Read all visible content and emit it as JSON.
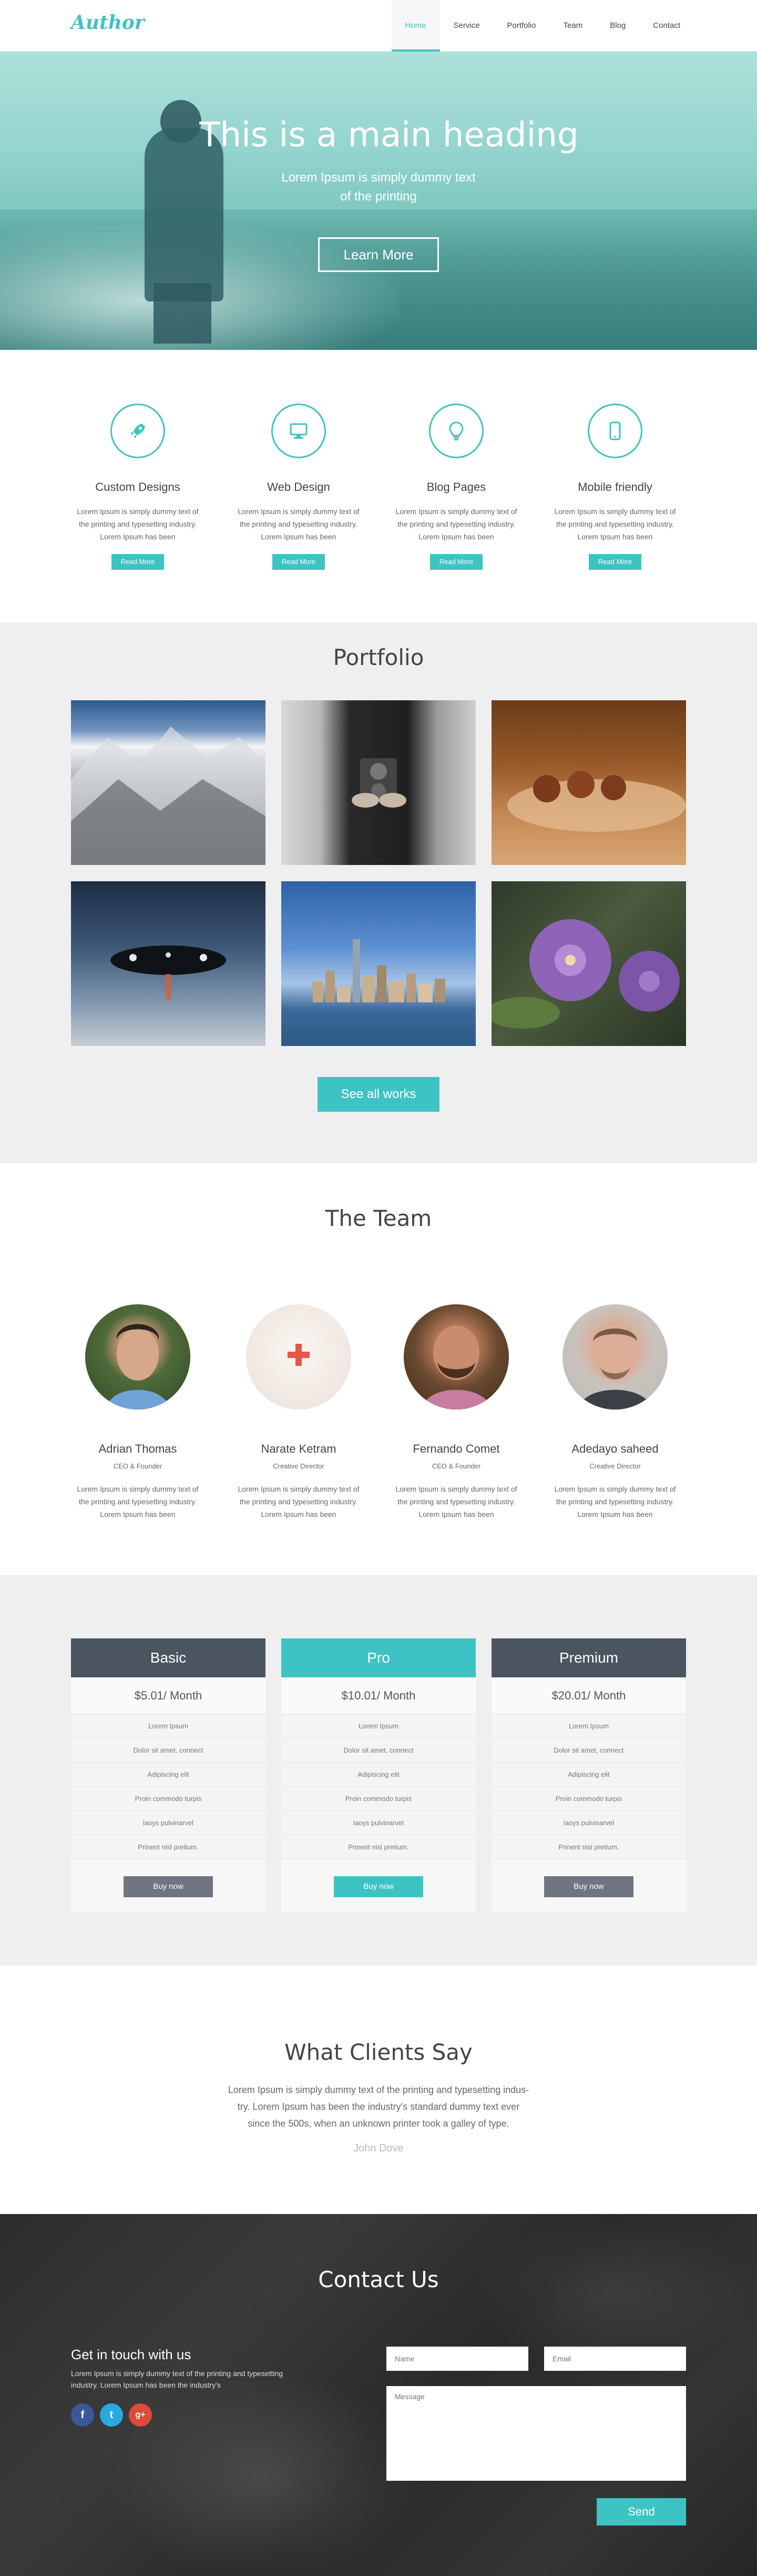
{
  "nav": {
    "logo": "Author",
    "items": [
      "Home",
      "Service",
      "Portfolio",
      "Team",
      "Blog",
      "Contact"
    ],
    "active": "Home"
  },
  "hero": {
    "heading": "This is a main heading",
    "sub_line1": "Lorem Ipsum is simply dummy text",
    "sub_line2": "of the printing",
    "button": "Learn More"
  },
  "services": [
    {
      "icon": "rocket-icon",
      "title": "Custom Designs",
      "line1": "Lorem Ipsum is simply dummy text of",
      "line2": "the printing and typesetting industry.",
      "line3": "Lorem Ipsum has been",
      "button": "Read More"
    },
    {
      "icon": "monitor-icon",
      "title": "Web Design",
      "line1": "Lorem Ipsum is simply dummy text of",
      "line2": "the printing and typesetting industry.",
      "line3": "Lorem Ipsum has been",
      "button": "Read More"
    },
    {
      "icon": "lightbulb-icon",
      "title": "Blog Pages",
      "line1": "Lorem Ipsum is simply dummy text of",
      "line2": "the printing and typesetting industry.",
      "line3": "Lorem Ipsum has been",
      "button": "Read More"
    },
    {
      "icon": "mobile-icon",
      "title": "Mobile friendly",
      "line1": "Lorem Ipsum is simply dummy text of",
      "line2": "the printing and typesetting industry.",
      "line3": "Lorem Ipsum has been",
      "button": "Read More"
    }
  ],
  "portfolio": {
    "title": "Portfolio",
    "button": "See all works"
  },
  "team": {
    "title": "The Team",
    "members": [
      {
        "name": "Adrian Thomas",
        "role": "CEO & Founder",
        "line1": "Lorem Ipsum is simply dummy text of",
        "line2": "the printing and typesetting industry.",
        "line3": "Lorem Ipsum has been"
      },
      {
        "name": "Narate Ketram",
        "role": "Creative Director",
        "line1": "Lorem Ipsum is simply dummy text of",
        "line2": "the printing and typesetting industry.",
        "line3": "Lorem Ipsum has been"
      },
      {
        "name": "Fernando Comet",
        "role": "CEO & Founder",
        "line1": "Lorem Ipsum is simply dummy text of",
        "line2": "the printing and typesetting industry.",
        "line3": "Lorem Ipsum has been"
      },
      {
        "name": "Adedayo saheed",
        "role": "Creative Director",
        "line1": "Lorem Ipsum is simply dummy text of",
        "line2": "the printing and typesetting industry.",
        "line3": "Lorem Ipsum has been"
      }
    ]
  },
  "pricing": {
    "plans": [
      {
        "name": "Basic",
        "price": "$5.01/ Month",
        "button": "Buy now"
      },
      {
        "name": "Pro",
        "price": "$10.01/ Month",
        "button": "Buy now"
      },
      {
        "name": "Premium",
        "price": "$20.01/ Month",
        "button": "Buy now"
      }
    ],
    "features": [
      "Lorem Ipsum",
      "Dolor sit amet, connect",
      "Adipiscing elit",
      "Proin commodo turpis",
      "laoys pulvinarvel",
      "Prinent nisl pretium."
    ]
  },
  "clients": {
    "title": "What Clients Say",
    "line1": "Lorem Ipsum is simply dummy text of the printing and typesetting indus-",
    "line2": "try. Lorem Ipsum has been the industry's standard dummy text ever",
    "line3": "since the 500s, when an unknown printer took a galley of type.",
    "author": "John Dove"
  },
  "contact": {
    "title": "Contact Us",
    "get_in_touch": "Get in touch with us",
    "text_line1": "Lorem Ipsum is simply dummy text of the printing and typesetting",
    "text_line2": "industry. Lorem Ipsum has been the industry's",
    "name_placeholder": "Name",
    "email_placeholder": "Email",
    "message_placeholder": "Message",
    "send": "Send",
    "social": [
      "f",
      "t",
      "g+"
    ]
  },
  "colors": {
    "accent": "#3ec3c4",
    "dark_slate": "#4a5560",
    "muted_gray": "#6f7680"
  }
}
